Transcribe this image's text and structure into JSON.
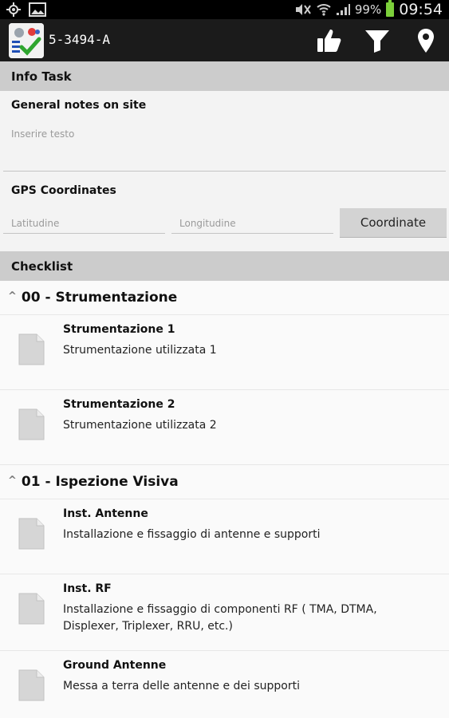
{
  "status_bar": {
    "icons_left": [
      "gps-icon",
      "image-icon"
    ],
    "icons_right": [
      "mute-icon",
      "wifi-icon",
      "signal-icon",
      "battery-icon"
    ],
    "battery": "99%",
    "time": "09:54"
  },
  "action_bar": {
    "title": "5-3494-A",
    "actions": [
      "thumbs-up-icon",
      "filter-icon",
      "location-pin-icon"
    ]
  },
  "info_task": {
    "header": "Info Task",
    "notes_label": "General notes on site",
    "notes_placeholder": "Inserire testo",
    "gps_label": "GPS Coordinates",
    "lat_placeholder": "Latitudine",
    "lon_placeholder": "Longitudine",
    "coord_button": "Coordinate"
  },
  "checklist": {
    "header": "Checklist",
    "groups": [
      {
        "title": "00 - Strumentazione",
        "items": [
          {
            "title": "Strumentazione 1",
            "desc": "Strumentazione utilizzata 1"
          },
          {
            "title": "Strumentazione 2",
            "desc": "Strumentazione utilizzata 2"
          }
        ]
      },
      {
        "title": "01 - Ispezione Visiva",
        "items": [
          {
            "title": "Inst. Antenne",
            "desc": "Installazione e fissaggio di antenne e supporti"
          },
          {
            "title": "Inst. RF",
            "desc": "Installazione e fissaggio di componenti RF ( TMA, DTMA, Displexer, Triplexer, RRU, etc.)"
          },
          {
            "title": "Ground Antenne",
            "desc": "Messa a terra delle antenne e dei supporti"
          }
        ]
      }
    ]
  }
}
